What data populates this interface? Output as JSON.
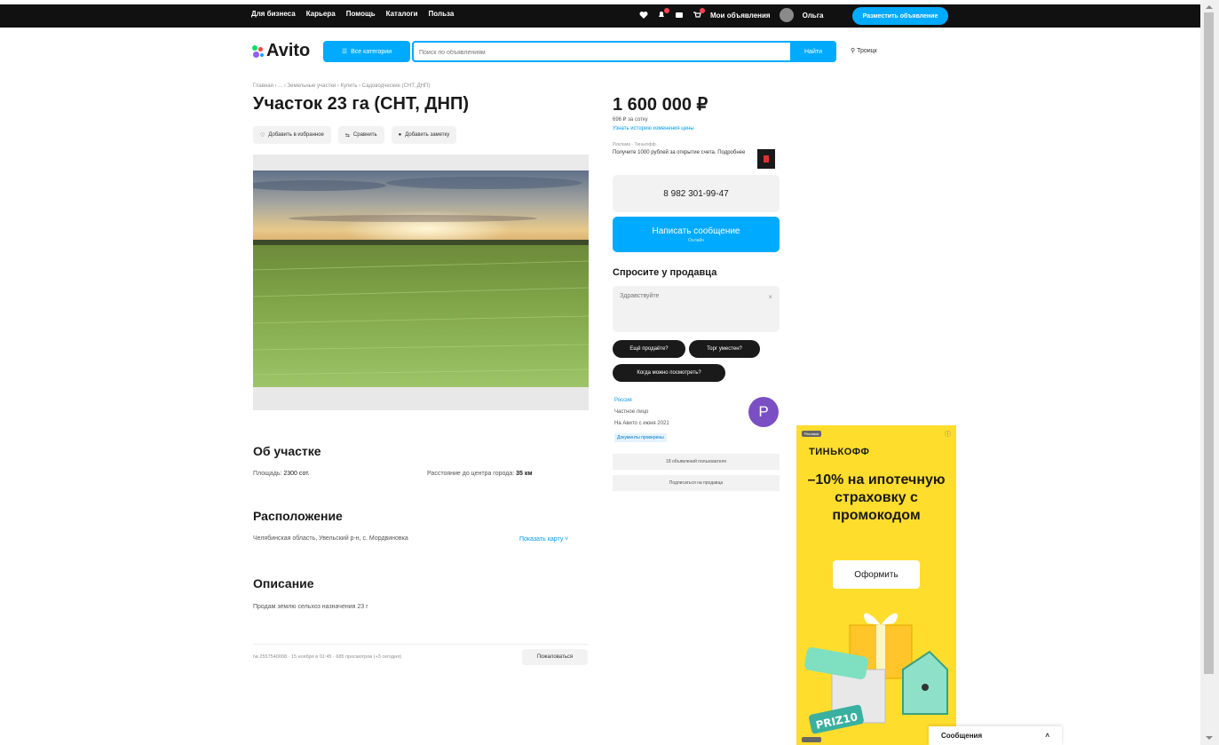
{
  "topbar": {
    "nav": [
      "Для бизнеса",
      "Карьера",
      "Помощь",
      "Каталоги",
      "Польза"
    ],
    "my_ads": "Мои объявления",
    "user": "Ольга",
    "post_ad": "Разместить объявление"
  },
  "header": {
    "logo": "Avito",
    "categories": "Все категории",
    "search_placeholder": "Поиск по объявлениям",
    "search_button": "Найти",
    "location": "Троицк"
  },
  "breadcrumb": "Главная › ... › Земельные участки › Купить › Садоводческие (СНТ, ДНП)",
  "listing": {
    "title": "Участок 23 га (СНТ, ДНП)",
    "actions": [
      "Добавить в избранное",
      "Сравнить",
      "Добавить заметку"
    ]
  },
  "about": {
    "title": "Об участке",
    "area_label": "Площадь:",
    "area_value": "2300 сот.",
    "distance_label": "Расстояние до центра города:",
    "distance_value": "35 км"
  },
  "location_section": {
    "title": "Расположение",
    "address": "Челябинская область, Увельский р-н, с. Мордвиновка",
    "map_link": "Показать карту"
  },
  "description": {
    "title": "Описание",
    "text": "Продам землю сельхоз назначения 23 г"
  },
  "footer": {
    "meta": "№ 2557540008 · 15 ноября в 01:45 · 685 просмотров (+3 сегодня)",
    "report": "Пожаловаться"
  },
  "sidebar": {
    "price": "1 600 000 ₽",
    "price_per": "696 ₽ за сотку",
    "price_history": "Узнать историю изменения цены",
    "promo_label": "Реклама · Тинькофф",
    "promo_text": "Получите 1000 рублей за открытие счета. Подробнее",
    "phone": "8 982 301-99-47",
    "message_button": "Написать сообщение",
    "message_sub": "Онлайн",
    "ask_title": "Спросите у продавца",
    "ask_placeholder": "Здравствуйте",
    "chips": [
      "Ещё продаёте?",
      "Торг уместен?",
      "Когда можно посмотреть?"
    ],
    "seller_name": "Россия",
    "seller_type": "Частное лицо",
    "seller_since": "На Авито с июня 2021",
    "seller_tag": "Документы проверены",
    "seller_avatar_letter": "Р",
    "btn_all_ads": "18 объявлений пользователя",
    "btn_subscribe": "Подписаться на продавца"
  },
  "ad": {
    "label": "Реклама",
    "brand": "ТИНЬКОФФ",
    "headline": "–10% на ипотечную страховку с промокодом",
    "cta": "Оформить",
    "promo_word": "PRIZ10"
  },
  "messages_bar": {
    "label": "Сообщения"
  }
}
